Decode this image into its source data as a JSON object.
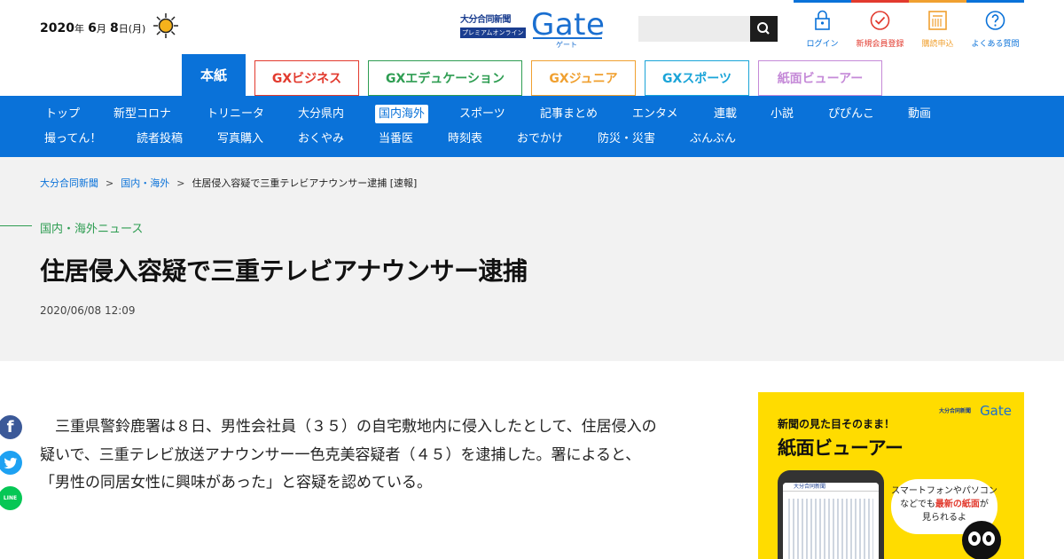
{
  "header": {
    "date": {
      "year": "2020",
      "year_unit": "年",
      "month": "6",
      "month_unit": "月",
      "day": "8",
      "day_unit": "日",
      "weekday": "(月)"
    },
    "weather_icon": "sun-icon",
    "logo": {
      "publisher": "大分合同新聞",
      "tagline": "プレミアムオンライン",
      "brand": "Gate",
      "brand_kana": "ゲート"
    },
    "search": {
      "placeholder": "",
      "button_icon": "search-icon"
    },
    "utility_links": [
      {
        "label": "ログイン",
        "icon": "lock-icon",
        "color": "#0a72d9"
      },
      {
        "label": "新規会員登録",
        "icon": "check-circle-icon",
        "color": "#e23a2e"
      },
      {
        "label": "購読申込",
        "icon": "newspaper-icon",
        "color": "#f0a030"
      },
      {
        "label": "よくある質問",
        "icon": "question-icon",
        "color": "#0a72d9"
      }
    ]
  },
  "paper_tabs": [
    {
      "label": "本紙",
      "color": "#0a72d9",
      "active": true
    },
    {
      "label": "GXビジネス",
      "color": "#e23a2e"
    },
    {
      "label": "GXエデュケーション",
      "color": "#2e9d52"
    },
    {
      "label": "GXジュニア",
      "color": "#f0a030"
    },
    {
      "label": "GXスポーツ",
      "color": "#1aa4d8"
    },
    {
      "label": "紙面ビューアー",
      "color": "#c58ad8"
    }
  ],
  "nav": {
    "row1": [
      "トップ",
      "新型コロナ",
      "トリニータ",
      "大分県内",
      "国内海外",
      "スポーツ",
      "記事まとめ",
      "エンタメ",
      "連載",
      "小説",
      "ぴぴんこ",
      "動画"
    ],
    "row2": [
      "撮ってん！",
      "読者投稿",
      "写真購入",
      "おくやみ",
      "当番医",
      "時刻表",
      "おでかけ",
      "防災・災害",
      "ぶんぶん"
    ],
    "active": "国内海外"
  },
  "breadcrumb": {
    "items": [
      "大分合同新聞",
      "国内・海外",
      "住居侵入容疑で三重テレビアナウンサー逮捕 [速報]"
    ],
    "separator": ">"
  },
  "article": {
    "category": "国内・海外ニュース",
    "title": "住居侵入容疑で三重テレビアナウンサー逮捕",
    "published": "2020/06/08 12:09",
    "body": [
      "　三重県警鈴鹿署は８日、男性会社員（３５）の自宅敷地内に侵入したとして、住居侵入の",
      "疑いで、三重テレビ放送アナウンサー一色克美容疑者（４５）を逮捕した。署によると、",
      "「男性の同居女性に興味があった」と容疑を認めている。"
    ]
  },
  "share": [
    {
      "name": "facebook",
      "icon": "facebook-icon",
      "color": "#3b5998",
      "glyph": "f"
    },
    {
      "name": "twitter",
      "icon": "twitter-icon",
      "color": "#1da1f2",
      "glyph": "t"
    },
    {
      "name": "line",
      "icon": "line-icon",
      "color": "#06c755",
      "glyph": "LINE"
    }
  ],
  "ad": {
    "logo_brand": "Gate",
    "logo_publisher": "大分合同新聞",
    "tag": "新聞の見た目そのまま！",
    "title": "紙面ビューアー",
    "phone_header": "大分合同新聞",
    "bubble_pre": "スマートフォンやパソコン",
    "bubble_mid_a": "などでも",
    "bubble_hl": "最新の紙面",
    "bubble_mid_b": "が",
    "bubble_post": "見られるよ",
    "bg_color": "#ffdc00"
  }
}
